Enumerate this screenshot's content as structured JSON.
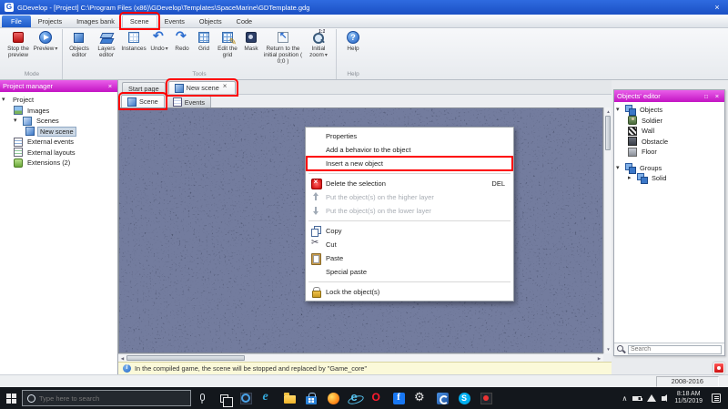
{
  "window": {
    "title": "GDevelop - [Project] C:\\Program Files (x86)\\GDevelop\\Templates\\SpaceMarine\\GDTemplate.gdg"
  },
  "colors": {
    "titlebar_blue": "#1d57d0",
    "pane_title_magenta": "#c313c3",
    "annotation_red": "#fe0000",
    "canvas_navy": "#262e4e",
    "info_bar_yellow": "#fbf9d9",
    "taskbar_black": "#13171c"
  },
  "ribbon": {
    "tabs": [
      {
        "label": "File"
      },
      {
        "label": "Projects"
      },
      {
        "label": "Images bank"
      },
      {
        "label": "Scene",
        "annotated": true,
        "active": true
      },
      {
        "label": "Events"
      },
      {
        "label": "Objects"
      },
      {
        "label": "Code"
      }
    ],
    "groups": [
      {
        "label": "Mode"
      },
      {
        "label": "Tools"
      },
      {
        "label": "Help"
      }
    ],
    "buttons": [
      {
        "label": "Stop the preview",
        "icon": "stop"
      },
      {
        "label": "Preview",
        "icon": "play",
        "dropdown": true
      },
      {
        "label": "Objects editor",
        "icon": "objects"
      },
      {
        "label": "Layers editor",
        "icon": "layers"
      },
      {
        "label": "Instances",
        "icon": "instances"
      },
      {
        "label": "Undo",
        "icon": "undo",
        "dropdown": true
      },
      {
        "label": "Redo",
        "icon": "redo"
      },
      {
        "label": "Grid",
        "icon": "grid"
      },
      {
        "label": "Edit the grid",
        "icon": "edit-grid"
      },
      {
        "label": "Mask",
        "icon": "mask"
      },
      {
        "label": "Return to the initial position ( 0;0 )",
        "icon": "return-initial"
      },
      {
        "label": "Initial zoom",
        "icon": "initial-zoom",
        "dropdown": true
      },
      {
        "label": "Help",
        "icon": "help"
      }
    ]
  },
  "project_manager": {
    "title": "Project manager",
    "root": "Project",
    "items": [
      {
        "label": "Images",
        "icon": "images",
        "level": 1
      },
      {
        "label": "Scenes",
        "icon": "scenes",
        "level": 1,
        "expanded": true
      },
      {
        "label": "New scene",
        "icon": "scene",
        "level": 2,
        "selected": true
      },
      {
        "label": "External events",
        "icon": "external-events",
        "level": 1
      },
      {
        "label": "External layouts",
        "icon": "external-layouts",
        "level": 1
      },
      {
        "label": "Extensions (2)",
        "icon": "extensions",
        "level": 1
      }
    ]
  },
  "document_tabs": [
    {
      "label": "Start page"
    },
    {
      "label": "New scene",
      "active": true,
      "closable": true,
      "annotated": true
    }
  ],
  "scene_tabs": [
    {
      "label": "Scene",
      "active": true,
      "annotated": true
    },
    {
      "label": "Events"
    }
  ],
  "context_menu": {
    "items": [
      {
        "label": "Properties"
      },
      {
        "label": "Add a behavior to the object"
      },
      {
        "label": "Insert a new object",
        "annotated": true
      },
      {
        "separator": true
      },
      {
        "label": "Delete the selection",
        "shortcut": "DEL",
        "icon": "delete"
      },
      {
        "label": "Put the object(s) on the higher layer",
        "icon": "layer-up",
        "disabled": true
      },
      {
        "label": "Put the object(s) on the lower layer",
        "icon": "layer-down",
        "disabled": true
      },
      {
        "separator": true
      },
      {
        "label": "Copy",
        "icon": "copy"
      },
      {
        "label": "Cut",
        "icon": "cut"
      },
      {
        "label": "Paste",
        "icon": "paste"
      },
      {
        "label": "Special paste"
      },
      {
        "separator": true
      },
      {
        "label": "Lock the object(s)",
        "icon": "lock"
      }
    ]
  },
  "objects_editor": {
    "title": "Objects' editor",
    "nodes": [
      {
        "label": "Objects",
        "icon": "objects-group",
        "level": 0,
        "expanded": true
      },
      {
        "label": "Soldier",
        "icon": "soldier",
        "level": 1
      },
      {
        "label": "Wall",
        "icon": "wall",
        "level": 1
      },
      {
        "label": "Obstacle",
        "icon": "obstacle",
        "level": 1
      },
      {
        "label": "Floor",
        "icon": "floor",
        "level": 1
      },
      {
        "label": "Groups",
        "icon": "groups",
        "level": 0,
        "expanded": true
      },
      {
        "label": "Solid",
        "icon": "solid",
        "level": 1,
        "collapsed": true
      }
    ],
    "search_placeholder": "Search"
  },
  "info_bar": {
    "text": "In the compiled game, the scene will be stopped and replaced by \"Game_core\""
  },
  "status_bar": {
    "copyright": "2008-2016"
  },
  "taskbar": {
    "search_placeholder": "Type here to search",
    "time": "8:18 AM",
    "date": "11/5/2019",
    "icons": [
      "start",
      "cortana-search",
      "microphone",
      "task-view",
      "photos",
      "edge",
      "file-explorer",
      "store",
      "firefox",
      "internet-explorer",
      "opera",
      "facebook",
      "settings",
      "gdevelop",
      "skype",
      "recorder",
      "tray-expand",
      "battery",
      "network",
      "volume",
      "action-center"
    ]
  }
}
